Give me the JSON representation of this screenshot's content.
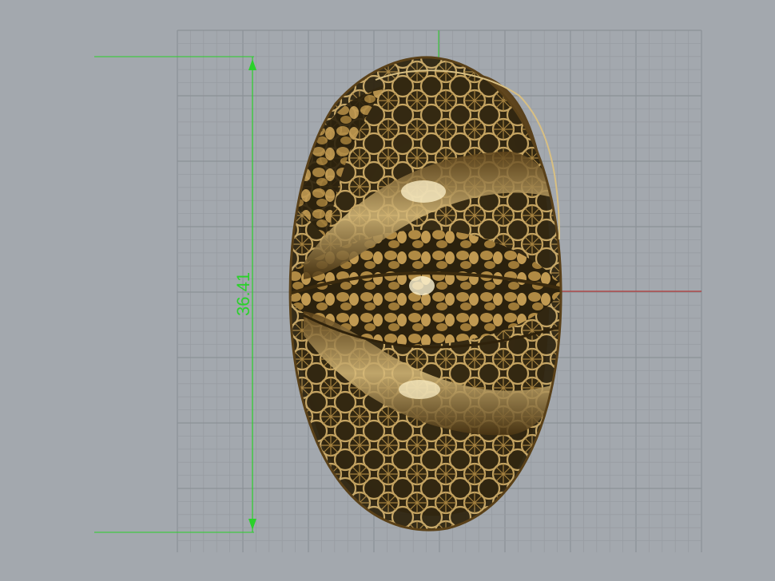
{
  "viewport": {
    "background": "#a3a8ae",
    "grid_color_minor": "#979ca2",
    "grid_color_major": "#8c9196",
    "axis_x_color": "#b43a3a",
    "axis_y_color": "#2bd12b"
  },
  "dimension": {
    "value_text": "36.41",
    "color": "#2bd12b"
  },
  "model": {
    "name": "filigree-ring-model",
    "material_color": "#9c7a3c"
  }
}
